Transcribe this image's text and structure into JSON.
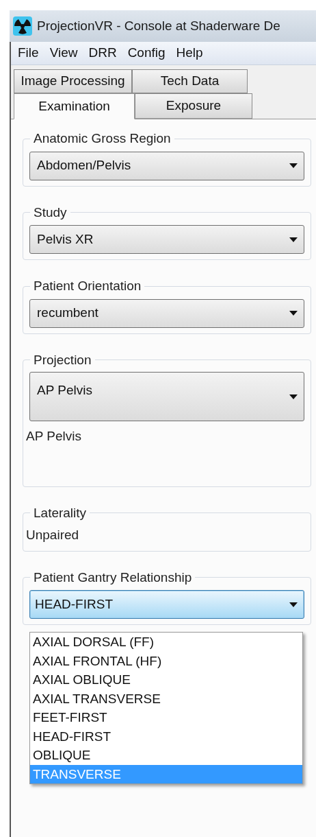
{
  "window": {
    "title": "ProjectionVR - Console at Shaderware De"
  },
  "menu": [
    "File",
    "View",
    "DRR",
    "Config",
    "Help"
  ],
  "tab_rows": [
    [
      {
        "label": "Image Processing",
        "selected": false
      },
      {
        "label": "Tech Data",
        "selected": false
      }
    ],
    [
      {
        "label": "Examination",
        "selected": true
      },
      {
        "label": "Exposure",
        "selected": false
      }
    ]
  ],
  "groups": [
    {
      "legend": "Anatomic Gross Region",
      "kind": "combo",
      "value": "Abdomen/Pelvis"
    },
    {
      "legend": "Study",
      "kind": "combo",
      "value": "Pelvis XR"
    },
    {
      "legend": "Patient Orientation",
      "kind": "combo",
      "value": "recumbent"
    },
    {
      "legend": "Projection",
      "kind": "combo",
      "value": "AP Pelvis",
      "caption": "AP Pelvis"
    },
    {
      "legend": "Laterality",
      "kind": "text",
      "value": "Unpaired"
    },
    {
      "legend": "Patient Gantry Relationship",
      "kind": "combo",
      "value": "HEAD-FIRST",
      "focused": true,
      "expanded": true,
      "options": [
        {
          "label": "AXIAL DORSAL (FF)",
          "highlighted": false
        },
        {
          "label": "AXIAL FRONTAL (HF)",
          "highlighted": false
        },
        {
          "label": "AXIAL OBLIQUE",
          "highlighted": false
        },
        {
          "label": "AXIAL TRANSVERSE",
          "highlighted": false
        },
        {
          "label": "FEET-FIRST",
          "highlighted": false
        },
        {
          "label": "HEAD-FIRST",
          "highlighted": false
        },
        {
          "label": "OBLIQUE",
          "highlighted": false
        },
        {
          "label": "TRANSVERSE",
          "highlighted": true
        }
      ]
    }
  ]
}
